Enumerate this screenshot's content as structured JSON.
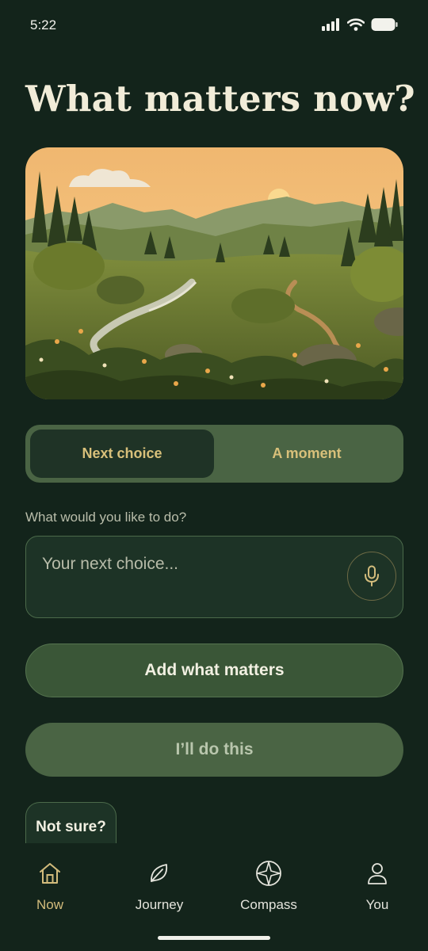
{
  "status": {
    "time": "5:22"
  },
  "page": {
    "title": "What matters now?"
  },
  "hero": {
    "image_name": "forest-valley-illustration"
  },
  "segmented": {
    "options": [
      "Next choice",
      "A moment"
    ],
    "selected": "Next choice"
  },
  "input": {
    "label": "What would you like to do?",
    "placeholder": "Your next choice...",
    "value": ""
  },
  "actions": {
    "add_label": "Add what matters",
    "do_label": "I’ll do this",
    "not_sure_label": "Not sure?"
  },
  "tabs": [
    {
      "label": "Now",
      "icon": "home-icon",
      "active": true
    },
    {
      "label": "Journey",
      "icon": "leaf-icon",
      "active": false
    },
    {
      "label": "Compass",
      "icon": "compass-icon",
      "active": false
    },
    {
      "label": "You",
      "icon": "person-icon",
      "active": false
    }
  ],
  "colors": {
    "background": "#13241b",
    "accent": "#d3bc7c",
    "green": "#4a6444"
  }
}
